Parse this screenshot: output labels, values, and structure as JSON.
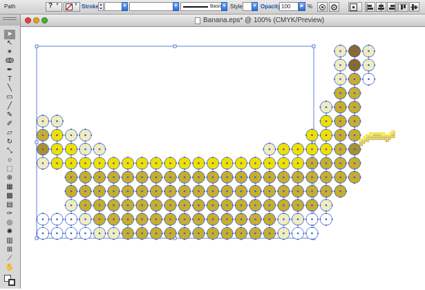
{
  "control_bar": {
    "selection_type": "Path",
    "stroke_label": "Stroke:",
    "stroke_profile": "Basic",
    "style_label": "Style:",
    "opacity_label": "Opacity:",
    "opacity_value": "100",
    "opacity_unit": "%"
  },
  "document": {
    "title": "Banana.eps* @ 100% (CMYK/Preview)"
  },
  "tools": [
    {
      "icon": "selection-tool-icon",
      "glyph": "➤",
      "active": true
    },
    {
      "icon": "direct-selection-tool-icon",
      "glyph": "↖",
      "active": false
    },
    {
      "icon": "magic-wand-tool-icon",
      "glyph": "✶",
      "active": false
    },
    {
      "icon": "lasso-tool-icon",
      "glyph": "ↂ",
      "active": false
    },
    {
      "icon": "pen-tool-icon",
      "glyph": "✒",
      "active": false
    },
    {
      "icon": "type-tool-icon",
      "glyph": "T",
      "active": false
    },
    {
      "icon": "line-segment-tool-icon",
      "glyph": "╲",
      "active": false
    },
    {
      "icon": "rectangle-tool-icon",
      "glyph": "▭",
      "active": false
    },
    {
      "icon": "paintbrush-tool-icon",
      "glyph": "╱",
      "active": false
    },
    {
      "icon": "pencil-tool-icon",
      "glyph": "✎",
      "active": false
    },
    {
      "icon": "blob-brush-tool-icon",
      "glyph": "✐",
      "active": false
    },
    {
      "icon": "eraser-tool-icon",
      "glyph": "▱",
      "active": false
    },
    {
      "icon": "rotate-tool-icon",
      "glyph": "↻",
      "active": false
    },
    {
      "icon": "scale-tool-icon",
      "glyph": "⤡",
      "active": false
    },
    {
      "icon": "warp-tool-icon",
      "glyph": "☼",
      "active": false
    },
    {
      "icon": "free-transform-tool-icon",
      "glyph": "⬚",
      "active": false
    },
    {
      "icon": "shape-builder-tool-icon",
      "glyph": "⊕",
      "active": false
    },
    {
      "icon": "perspective-grid-tool-icon",
      "glyph": "▦",
      "active": false
    },
    {
      "icon": "mesh-tool-icon",
      "glyph": "▩",
      "active": false
    },
    {
      "icon": "gradient-tool-icon",
      "glyph": "▤",
      "active": false
    },
    {
      "icon": "eyedropper-tool-icon",
      "glyph": "✑",
      "active": false
    },
    {
      "icon": "blend-tool-icon",
      "glyph": "◎",
      "active": false
    },
    {
      "icon": "symbol-sprayer-tool-icon",
      "glyph": "✺",
      "active": false
    },
    {
      "icon": "column-graph-tool-icon",
      "glyph": "▥",
      "active": false
    },
    {
      "icon": "artboard-tool-icon",
      "glyph": "⊞",
      "active": false
    },
    {
      "icon": "slice-tool-icon",
      "glyph": "⟋",
      "active": false
    },
    {
      "icon": "hand-tool-icon",
      "glyph": "✋",
      "active": false
    }
  ],
  "colors": {
    "selection_blue": "#3a5fcd",
    "banana_bright": "#f0e000",
    "banana_gold": "#c7ae2e",
    "banana_olive": "#a8922f",
    "banana_brown": "#8b6a2a",
    "banana_pale": "#f0ecc0"
  }
}
